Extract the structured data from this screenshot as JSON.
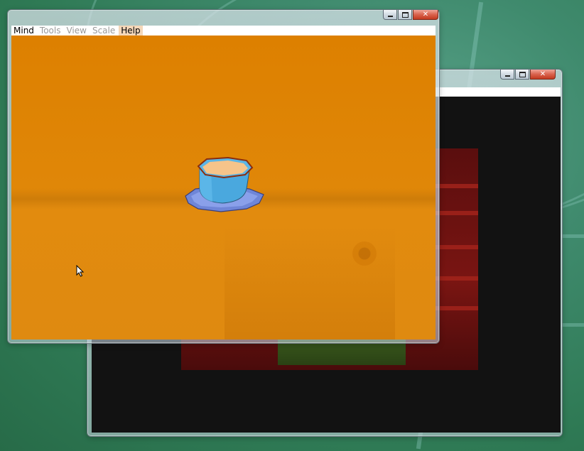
{
  "front_window": {
    "menu": {
      "items": [
        {
          "label": "Mind",
          "state": "enabled"
        },
        {
          "label": "Tools",
          "state": "disabled"
        },
        {
          "label": "View",
          "state": "disabled"
        },
        {
          "label": "Scale",
          "state": "disabled"
        },
        {
          "label": "Help",
          "state": "active"
        }
      ]
    },
    "caption_buttons": {
      "minimize_icon": "minimize-icon",
      "maximize_icon": "maximize-icon",
      "close_icon": "close-icon",
      "close_glyph": "✕"
    },
    "viewport": {
      "background": "#dd8000",
      "object": "teacup-on-saucer",
      "cup_color": "#4aa8de",
      "tea_color": "#f6c48a"
    }
  },
  "back_window": {
    "caption_buttons": {
      "minimize_icon": "minimize-icon",
      "maximize_icon": "maximize-icon",
      "close_icon": "close-icon",
      "close_glyph": "✕"
    },
    "client_background": "#121212",
    "scene_color": "#6d1310"
  },
  "desktop": {
    "wallpaper_color": "#3f8a6d"
  }
}
